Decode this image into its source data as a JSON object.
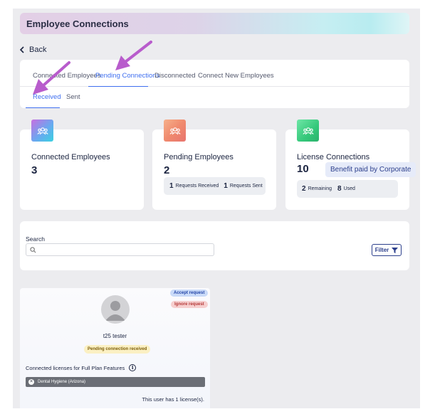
{
  "header": {
    "title": "Employee Connections"
  },
  "nav": {
    "back_label": "Back"
  },
  "tabs": {
    "primary": [
      {
        "label": "Connected Employees",
        "active": false
      },
      {
        "label": "Pending Connections",
        "active": true
      },
      {
        "label": "Disconnected",
        "active": false
      },
      {
        "label": "Connect New Employees",
        "active": false
      }
    ],
    "secondary": [
      {
        "label": "Received",
        "active": true
      },
      {
        "label": "Sent",
        "active": false
      }
    ]
  },
  "stats": {
    "connected": {
      "label": "Connected Employees",
      "value": "3",
      "icon": "group-icon",
      "accent": "#3ad1e0"
    },
    "pending": {
      "label": "Pending Employees",
      "value": "2",
      "icon": "group-icon",
      "accent": "#f08a6e",
      "received_count": "1",
      "received_label": "Requests Received",
      "sent_count": "1",
      "sent_label": "Requests Sent"
    },
    "license": {
      "label": "License Connections",
      "value": "10",
      "icon": "group-icon",
      "accent": "#34c87a",
      "benefit_label": "Benefit paid by Corporate",
      "remaining_count": "2",
      "remaining_label": "Remaining",
      "used_count": "8",
      "used_label": "Used"
    }
  },
  "search": {
    "label": "Search",
    "placeholder": "",
    "value": "",
    "filter_label": "Filter"
  },
  "user_card": {
    "accept_label": "Accept request",
    "ignore_label": "Ignore request",
    "name": "t25 tester",
    "status": "Pending connection received",
    "licenses_title": "Connected licenses for Full Plan Features",
    "license_items": [
      {
        "label": "Dental Hygiene (Arizona)"
      }
    ],
    "license_count_text": "This user has 1 license(s)."
  },
  "annotations": {
    "arrow_color": "#b85ccc"
  },
  "colors": {
    "accent_blue": "#3f6ff0",
    "navy": "#1c2541"
  }
}
